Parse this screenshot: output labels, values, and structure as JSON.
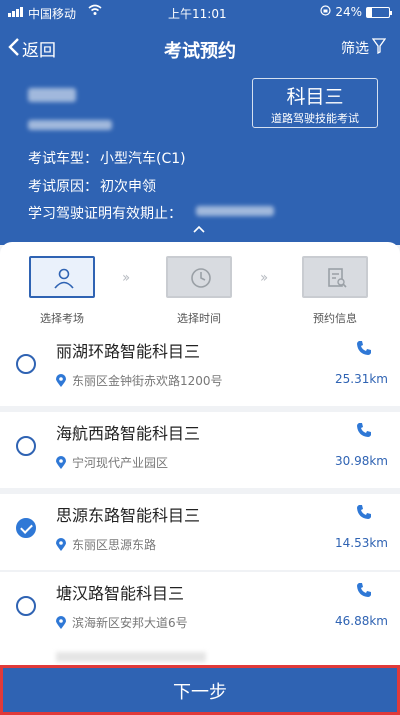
{
  "status_bar": {
    "carrier": "中国移动",
    "time": "上午11:01",
    "battery": "24%",
    "battery_level": 0.24
  },
  "nav": {
    "back_label": "返回",
    "title": "考试预约",
    "filter_label": "筛选"
  },
  "exam_info": {
    "subject_title": "科目三",
    "subject_desc": "道路驾驶技能考试",
    "vehicle_type_label": "考试车型：",
    "vehicle_type_value": "小型汽车(C1)",
    "reason_label": "考试原因：",
    "reason_value": "初次申领",
    "validity_label": "学习驾驶证明有效期止："
  },
  "steps": [
    {
      "label": "选择考场",
      "active": true
    },
    {
      "label": "选择时间",
      "active": false
    },
    {
      "label": "预约信息",
      "active": false
    }
  ],
  "venues": [
    {
      "name": "丽湖环路智能科目三",
      "address": "东丽区金钟街赤欢路1200号",
      "distance": "25.31km",
      "selected": false
    },
    {
      "name": "海航西路智能科目三",
      "address": "宁河现代产业园区",
      "distance": "30.98km",
      "selected": false
    },
    {
      "name": "思源东路智能科目三",
      "address": "东丽区思源东路",
      "distance": "14.53km",
      "selected": true
    },
    {
      "name": "塘汉路智能科目三",
      "address": "滨海新区安邦大道6号",
      "distance": "46.88km",
      "selected": false
    }
  ],
  "next_button_label": "下一步",
  "colors": {
    "primary": "#2f63b3",
    "highlight_border": "#e03a3a"
  }
}
